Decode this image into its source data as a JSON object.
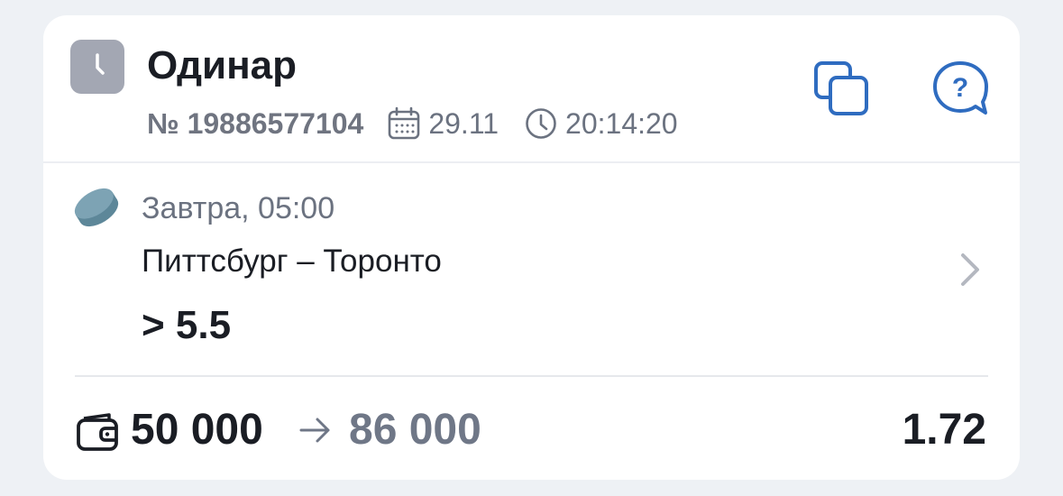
{
  "colors": {
    "accent": "#2f6cc0",
    "text_primary": "#1a1d24",
    "text_secondary": "#6b7280",
    "status_icon_bg": "#a3a7b3",
    "sport_icon": "#6f97a8",
    "chevron": "#b4b8c0"
  },
  "header": {
    "status_icon": "clock-icon",
    "bet_type": "Одинар",
    "bet_number": "№ 19886577104",
    "date": "29.11",
    "time": "20:14:20",
    "date_icon": "calendar-icon",
    "time_icon": "clock-icon",
    "copy_icon": "copy-icon",
    "help_icon": "help-bubble-icon"
  },
  "event": {
    "sport_icon": "hockey-puck-icon",
    "start_time": "Завтра, 05:00",
    "teams": "Питтсбург – Торонто",
    "selection": "> 5.5",
    "chevron_icon": "chevron-right-icon"
  },
  "footer": {
    "wallet_icon": "wallet-icon",
    "stake": "50 000",
    "arrow_icon": "arrow-right-icon",
    "payout": "86 000",
    "odds": "1.72"
  }
}
